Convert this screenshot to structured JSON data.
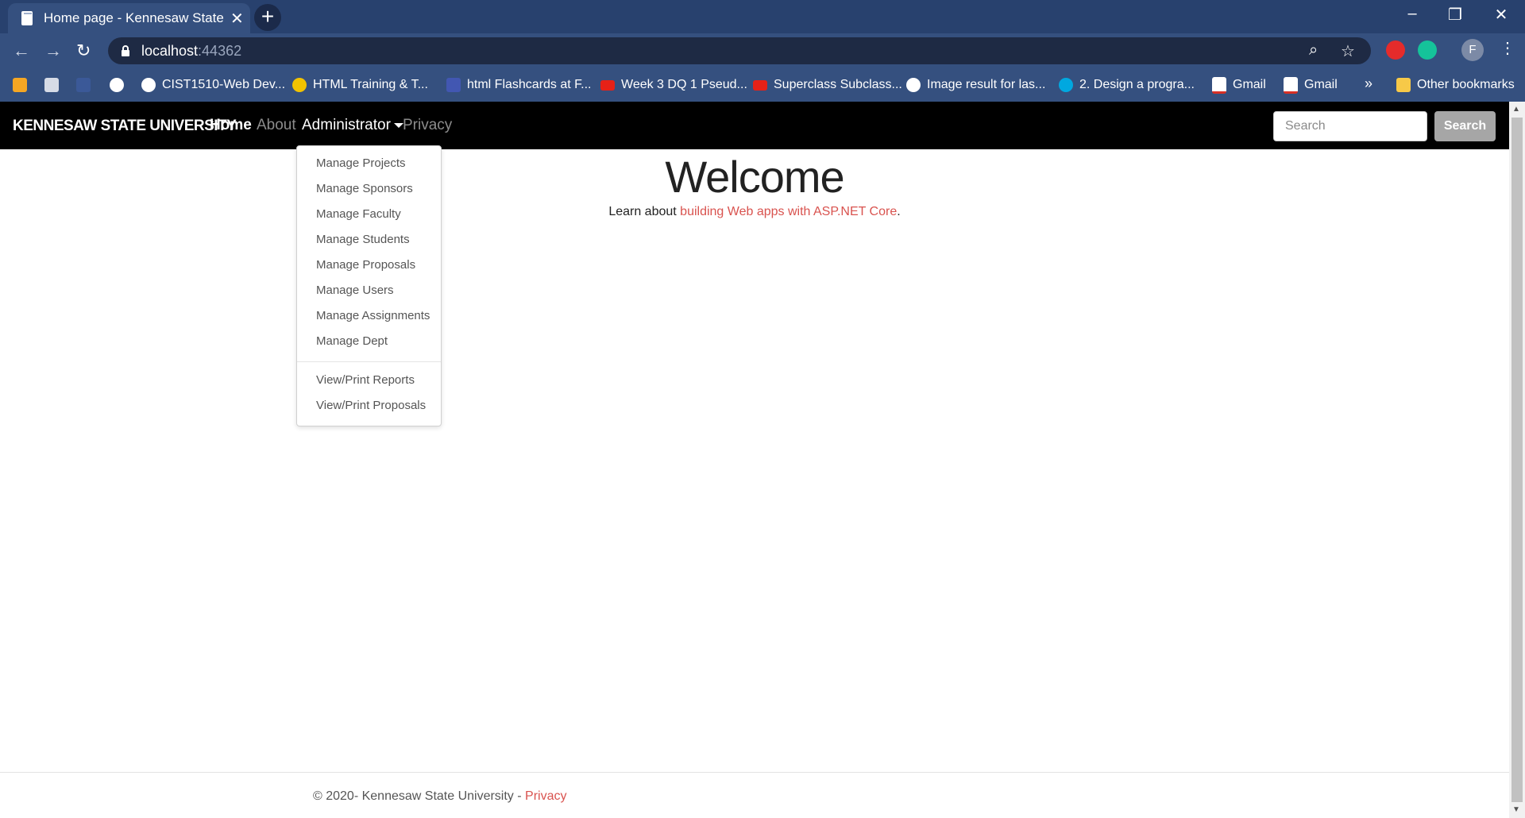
{
  "browser": {
    "tab_title": "Home page - Kennesaw State University",
    "new_tab": "+",
    "url_host": "localhost",
    "url_port": ":44362",
    "profile_initial": "F",
    "bookmarks": [
      {
        "label": "CIST1510-Web Dev...",
        "icon": "globe-icon"
      },
      {
        "label": "HTML Training & T...",
        "icon": "site-icon"
      },
      {
        "label": "html Flashcards at F...",
        "icon": "quizlet-icon"
      },
      {
        "label": "Week 3 DQ 1 Pseud...",
        "icon": "youtube-icon"
      },
      {
        "label": "Superclass Subclass...",
        "icon": "youtube-icon"
      },
      {
        "label": "Image result for las...",
        "icon": "google-icon"
      },
      {
        "label": "2. Design a progra...",
        "icon": "att-icon"
      },
      {
        "label": "Gmail",
        "icon": "gmail-icon"
      },
      {
        "label": "Gmail",
        "icon": "gmail-icon"
      }
    ],
    "bookmarks_more": "»",
    "other_bookmarks": "Other bookmarks"
  },
  "navbar": {
    "brand": "KENNESAW STATE UNIVERSITY",
    "links": {
      "home": "Home",
      "about": "About",
      "administrator": "Administrator",
      "privacy": "Privacy"
    },
    "search_placeholder": "Search",
    "search_button": "Search"
  },
  "admin_menu": {
    "items": [
      "Manage Projects",
      "Manage Sponsors",
      "Manage Faculty",
      "Manage Students",
      "Manage Proposals",
      "Manage Users",
      "Manage Assignments",
      "Manage Dept"
    ],
    "report_items": [
      "View/Print Reports",
      "View/Print Proposals"
    ]
  },
  "main": {
    "heading": "Welcome",
    "learn_prefix": "Learn about ",
    "learn_link": "building Web apps with ASP.NET Core",
    "learn_suffix": "."
  },
  "footer": {
    "copyright": "© 2020- Kennesaw State University - ",
    "privacy_link": "Privacy"
  },
  "colors": {
    "chrome_frame": "#28416e",
    "navbar_bg": "#000000",
    "link_accent": "#d9534f"
  }
}
